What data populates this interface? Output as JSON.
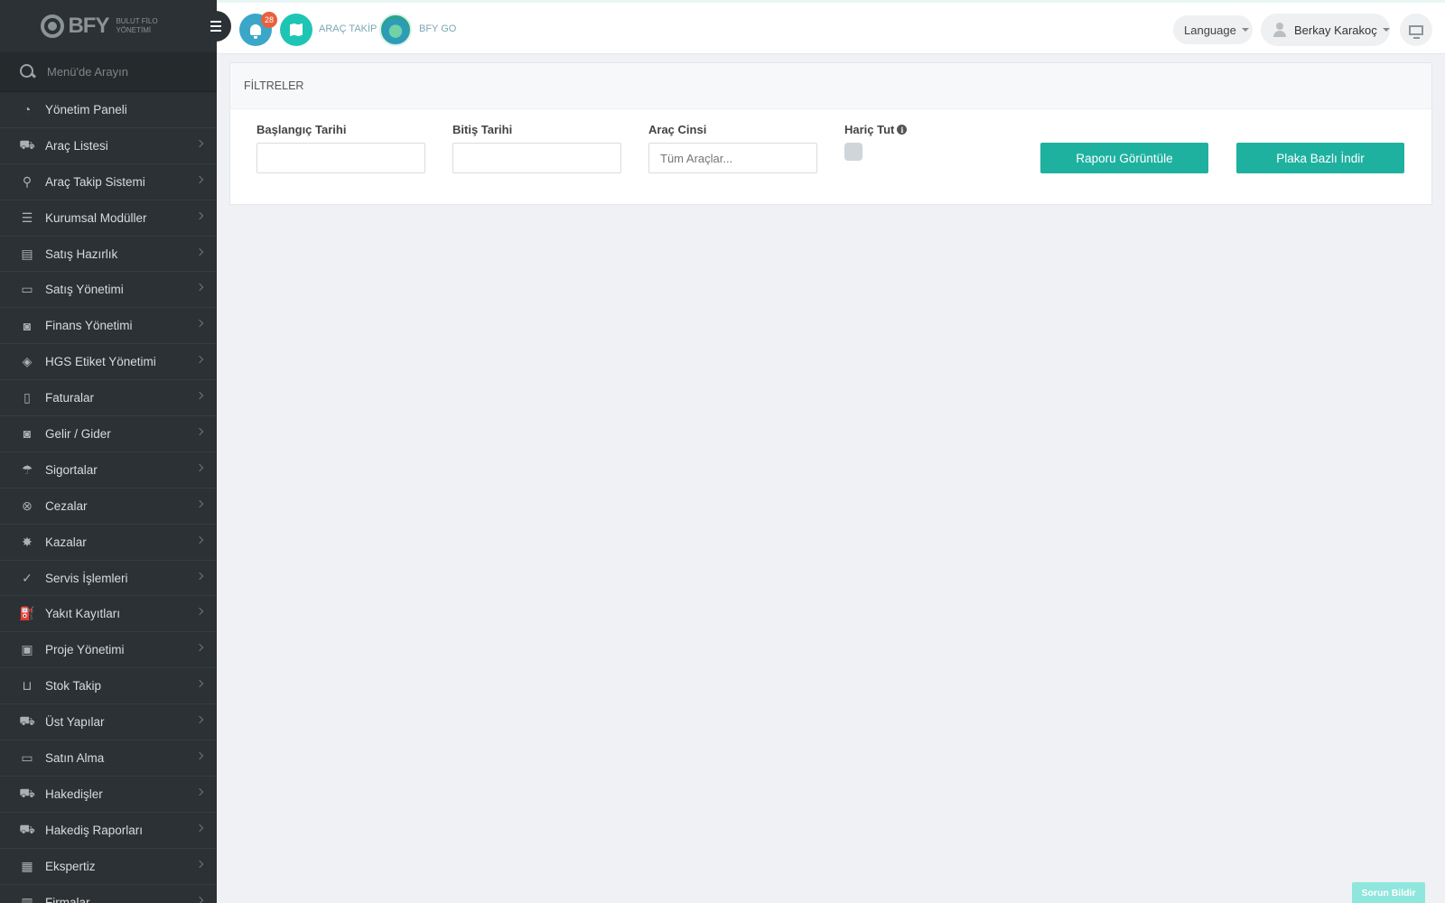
{
  "brand": {
    "name": "BFY",
    "subtitle_line1": "BULUT FİLO",
    "subtitle_line2": "YÖNETİMİ"
  },
  "search": {
    "placeholder": "Menü'de Arayın"
  },
  "sidebar": {
    "items": [
      {
        "label": "Yönetim Paneli",
        "icon": "dashboard-icon",
        "glyph": "◔",
        "chevron": false
      },
      {
        "label": "Araç Listesi",
        "icon": "car-icon",
        "glyph": "⛟",
        "chevron": true
      },
      {
        "label": "Araç Takip Sistemi",
        "icon": "map-marker-icon",
        "glyph": "⚲",
        "chevron": true
      },
      {
        "label": "Kurumsal Modüller",
        "icon": "server-icon",
        "glyph": "☰",
        "chevron": true
      },
      {
        "label": "Satış Hazırlık",
        "icon": "book-icon",
        "glyph": "▤",
        "chevron": true
      },
      {
        "label": "Satış Yönetimi",
        "icon": "credit-card-icon",
        "glyph": "▭",
        "chevron": true
      },
      {
        "label": "Finans Yönetimi",
        "icon": "money-icon",
        "glyph": "◙",
        "chevron": true
      },
      {
        "label": "HGS Etiket Yönetimi",
        "icon": "ticket-icon",
        "glyph": "◈",
        "chevron": true
      },
      {
        "label": "Faturalar",
        "icon": "file-icon",
        "glyph": "▯",
        "chevron": true
      },
      {
        "label": "Gelir / Gider",
        "icon": "money-icon",
        "glyph": "◙",
        "chevron": true
      },
      {
        "label": "Sigortalar",
        "icon": "umbrella-icon",
        "glyph": "☂",
        "chevron": true
      },
      {
        "label": "Cezalar",
        "icon": "times-circle-icon",
        "glyph": "⊗",
        "chevron": true
      },
      {
        "label": "Kazalar",
        "icon": "car-crash-icon",
        "glyph": "✸",
        "chevron": true
      },
      {
        "label": "Servis İşlemleri",
        "icon": "check-circle-icon",
        "glyph": "✓",
        "chevron": true
      },
      {
        "label": "Yakıt Kayıtları",
        "icon": "gas-pump-icon",
        "glyph": "⛽",
        "chevron": true
      },
      {
        "label": "Proje Yönetimi",
        "icon": "briefcase-icon",
        "glyph": "▣",
        "chevron": true
      },
      {
        "label": "Stok Takip",
        "icon": "inbox-icon",
        "glyph": "⊔",
        "chevron": true
      },
      {
        "label": "Üst Yapılar",
        "icon": "truck-icon",
        "glyph": "⛟",
        "chevron": true
      },
      {
        "label": "Satın Alma",
        "icon": "credit-card-icon",
        "glyph": "▭",
        "chevron": true
      },
      {
        "label": "Hakedişler",
        "icon": "truck-icon",
        "glyph": "⛟",
        "chevron": true
      },
      {
        "label": "Hakediş Raporları",
        "icon": "truck-icon",
        "glyph": "⛟",
        "chevron": true
      },
      {
        "label": "Ekspertiz",
        "icon": "newspaper-icon",
        "glyph": "▦",
        "chevron": true
      },
      {
        "label": "Firmalar",
        "icon": "building-icon",
        "glyph": "▥",
        "chevron": true
      }
    ]
  },
  "topbar": {
    "notification_count": "28",
    "arac_takip_label": "ARAÇ TAKİP",
    "bfy_go_label": "BFY GO",
    "language_label": "Language",
    "user_name": "Berkay Karakoç"
  },
  "filters": {
    "title": "FİLTRELER",
    "start_date_label": "Başlangıç Tarihi",
    "start_date_value": "",
    "end_date_label": "Bitiş Tarihi",
    "end_date_value": "",
    "vehicle_type_label": "Araç Cinsi",
    "vehicle_type_placeholder": "Tüm Araçlar...",
    "exclude_label": "Hariç Tut",
    "exclude_checked": false,
    "view_report_label": "Raporu Görüntüle",
    "download_by_plate_label": "Plaka Bazlı İndir"
  },
  "report_issue_label": "Sorun Bildir",
  "colors": {
    "sidebar_bg": "#2b3134",
    "accent": "#1fb1a0",
    "badge": "#e8603c",
    "page_bg": "#eff1f5"
  }
}
